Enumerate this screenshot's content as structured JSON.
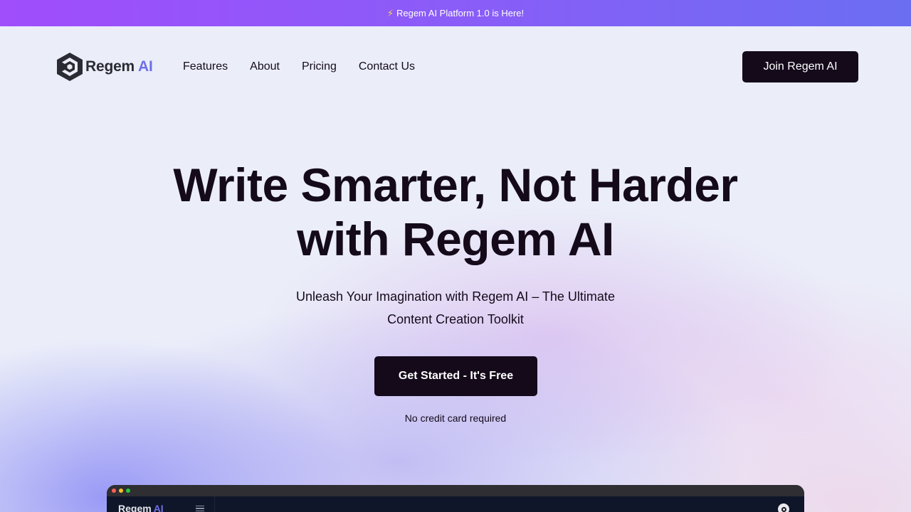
{
  "announcement": {
    "icon": "lightning-icon",
    "text": "Regem AI Platform 1.0 is Here!"
  },
  "brand": {
    "name": "Regem",
    "suffix": "AI",
    "accent": "#6f6fe6"
  },
  "nav": {
    "links": [
      "Features",
      "About",
      "Pricing",
      "Contact Us"
    ],
    "join_label": "Join Regem AI"
  },
  "hero": {
    "title_line1": "Write Smarter, Not Harder",
    "title_line2": "with Regem AI",
    "subtitle": "Unleash Your Imagination with Regem AI – The Ultimate Content Creation Toolkit",
    "cta_label": "Get Started - It's Free",
    "note": "No credit card required"
  },
  "preview": {
    "logo_name": "Regem",
    "logo_suffix": "AI"
  },
  "colors": {
    "dark": "#140a1a",
    "banner_start": "#a04dfb",
    "banner_end": "#6b6ef2"
  }
}
